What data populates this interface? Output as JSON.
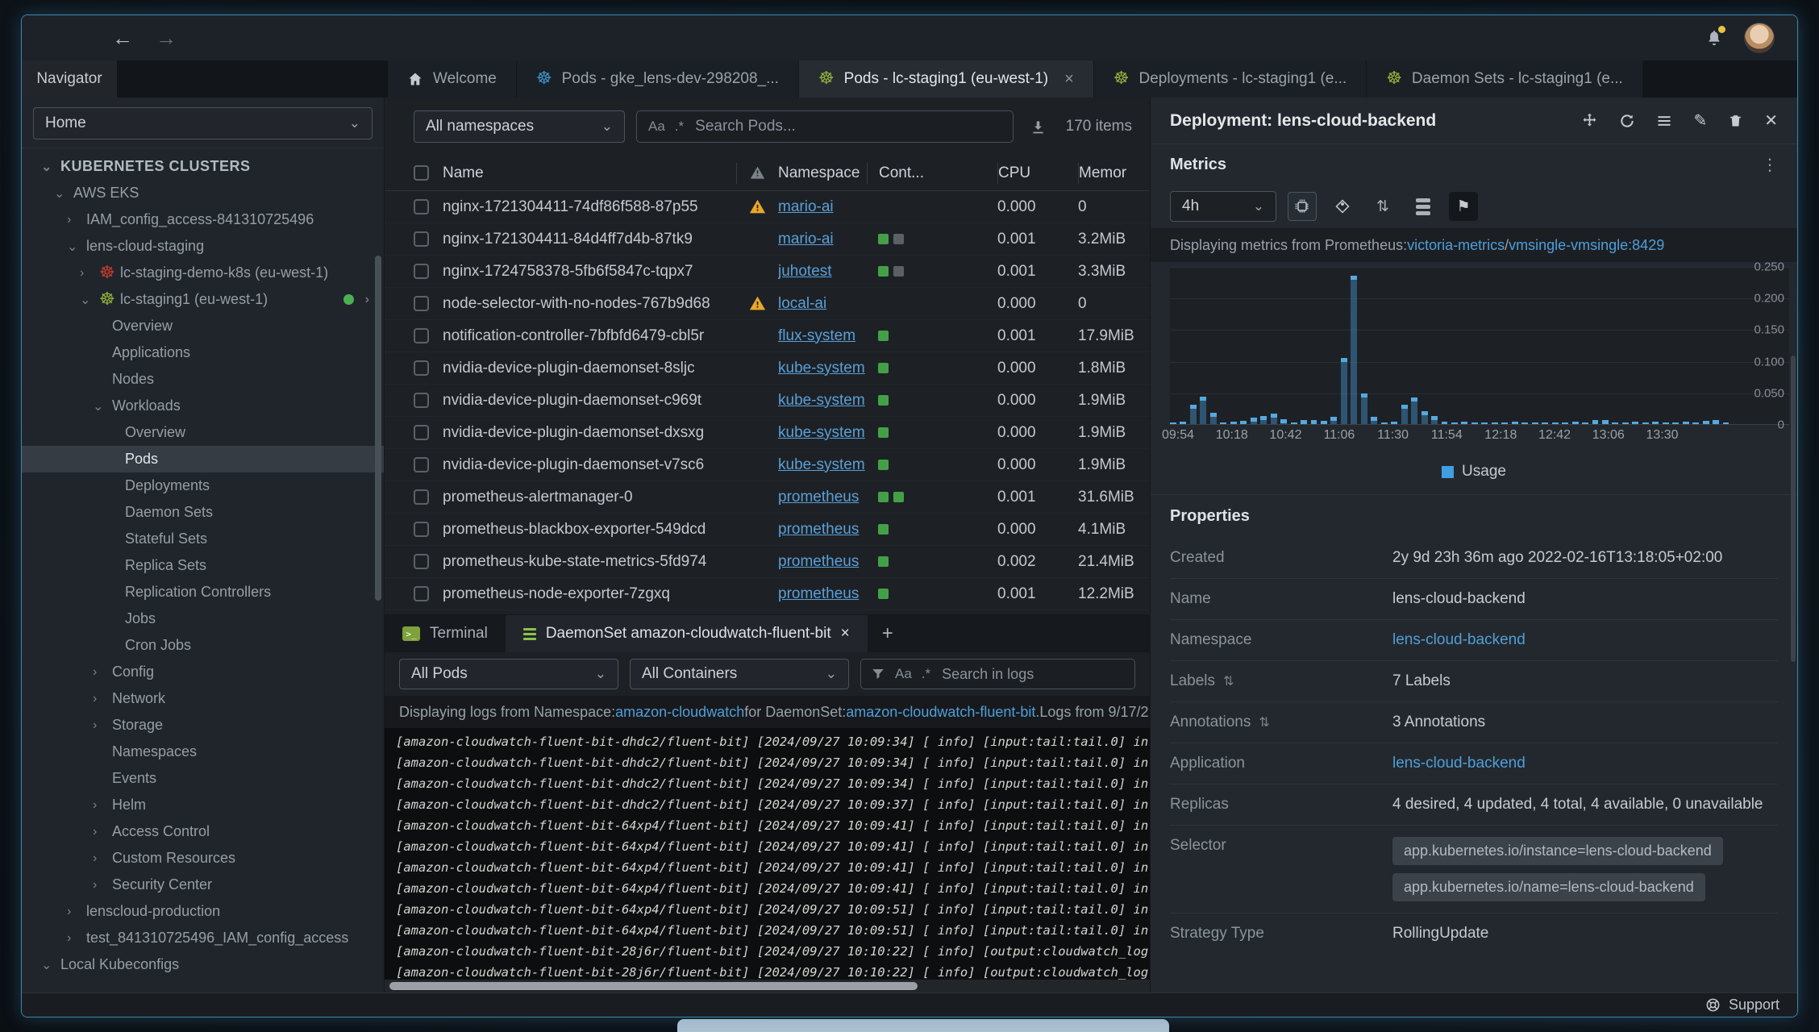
{
  "titlebar": {
    "back": "←",
    "forward": "→"
  },
  "tabs": {
    "navigator_label": "Navigator",
    "items": [
      {
        "label": "Welcome",
        "icon": "home",
        "active": false
      },
      {
        "label": "Pods - gke_lens-dev-298208_...",
        "icon": "k8s",
        "icon_color": "#3b8fc4",
        "active": false
      },
      {
        "label": "Pods - lc-staging1 (eu-west-1)",
        "icon": "k8s",
        "icon_color": "#8fae3a",
        "active": true,
        "closable": true
      },
      {
        "label": "Deployments - lc-staging1 (e...",
        "icon": "k8s",
        "icon_color": "#8fae3a",
        "active": false
      },
      {
        "label": "Daemon Sets - lc-staging1 (e...",
        "icon": "k8s",
        "icon_color": "#8fae3a",
        "active": false
      }
    ]
  },
  "sidebar": {
    "scope_select": "Home",
    "tree": [
      {
        "label": "KUBERNETES CLUSTERS",
        "depth": 0,
        "chevron": "down",
        "header": true
      },
      {
        "label": "AWS EKS",
        "depth": 1,
        "chevron": "down"
      },
      {
        "label": "IAM_config_access-841310725496",
        "depth": 2,
        "chevron": "right"
      },
      {
        "label": "lens-cloud-staging",
        "depth": 2,
        "chevron": "down"
      },
      {
        "label": "lc-staging-demo-k8s (eu-west-1)",
        "depth": 3,
        "chevron": "right",
        "icon": "k8s",
        "icon_color": "#c23b2e"
      },
      {
        "label": "lc-staging1 (eu-west-1)",
        "depth": 3,
        "chevron": "down",
        "icon": "k8s",
        "icon_color": "#8fae3a",
        "status_dot": true,
        "trail_chevron": "›"
      },
      {
        "label": "Overview",
        "depth": 4
      },
      {
        "label": "Applications",
        "depth": 4
      },
      {
        "label": "Nodes",
        "depth": 4
      },
      {
        "label": "Workloads",
        "depth": 4,
        "chevron": "down"
      },
      {
        "label": "Overview",
        "depth": 5
      },
      {
        "label": "Pods",
        "depth": 5,
        "selected": true
      },
      {
        "label": "Deployments",
        "depth": 5
      },
      {
        "label": "Daemon Sets",
        "depth": 5
      },
      {
        "label": "Stateful Sets",
        "depth": 5
      },
      {
        "label": "Replica Sets",
        "depth": 5
      },
      {
        "label": "Replication Controllers",
        "depth": 5
      },
      {
        "label": "Jobs",
        "depth": 5
      },
      {
        "label": "Cron Jobs",
        "depth": 5
      },
      {
        "label": "Config",
        "depth": 4,
        "chevron": "right"
      },
      {
        "label": "Network",
        "depth": 4,
        "chevron": "right"
      },
      {
        "label": "Storage",
        "depth": 4,
        "chevron": "right"
      },
      {
        "label": "Namespaces",
        "depth": 4
      },
      {
        "label": "Events",
        "depth": 4
      },
      {
        "label": "Helm",
        "depth": 4,
        "chevron": "right"
      },
      {
        "label": "Access Control",
        "depth": 4,
        "chevron": "right"
      },
      {
        "label": "Custom Resources",
        "depth": 4,
        "chevron": "right"
      },
      {
        "label": "Security Center",
        "depth": 4,
        "chevron": "right"
      },
      {
        "label": "lenscloud-production",
        "depth": 2,
        "chevron": "right"
      },
      {
        "label": "test_841310725496_IAM_config_access",
        "depth": 2,
        "chevron": "right"
      },
      {
        "label": "Local Kubeconfigs",
        "depth": 0,
        "chevron": "down"
      }
    ]
  },
  "pods_panel": {
    "namespace_select": "All namespaces",
    "case_icon": "Aa",
    "regex_icon": ".*",
    "search_placeholder": "Search Pods...",
    "items_count": "170 items",
    "columns": [
      "Name",
      "Namespace",
      "Cont...",
      "CPU",
      "Memor"
    ],
    "rows": [
      {
        "name": "nginx-1721304411-74df86f588-87p55",
        "warning": true,
        "namespace": "mario-ai",
        "containers": [],
        "cpu": "0.000",
        "memory": "0"
      },
      {
        "name": "nginx-1721304411-84d4ff7d4b-87tk9",
        "warning": false,
        "namespace": "mario-ai",
        "containers": [
          "ok",
          "idle"
        ],
        "cpu": "0.001",
        "memory": "3.2MiB"
      },
      {
        "name": "nginx-1724758378-5fb6f5847c-tqpx7",
        "warning": false,
        "namespace": "juhotest",
        "containers": [
          "ok",
          "idle"
        ],
        "cpu": "0.001",
        "memory": "3.3MiB"
      },
      {
        "name": "node-selector-with-no-nodes-767b9d68",
        "warning": true,
        "namespace": "local-ai",
        "containers": [],
        "cpu": "0.000",
        "memory": "0"
      },
      {
        "name": "notification-controller-7bfbfd6479-cbl5r",
        "warning": false,
        "namespace": "flux-system",
        "containers": [
          "ok"
        ],
        "cpu": "0.001",
        "memory": "17.9MiB"
      },
      {
        "name": "nvidia-device-plugin-daemonset-8sljc",
        "warning": false,
        "namespace": "kube-system",
        "containers": [
          "ok"
        ],
        "cpu": "0.000",
        "memory": "1.8MiB"
      },
      {
        "name": "nvidia-device-plugin-daemonset-c969t",
        "warning": false,
        "namespace": "kube-system",
        "containers": [
          "ok"
        ],
        "cpu": "0.000",
        "memory": "1.9MiB"
      },
      {
        "name": "nvidia-device-plugin-daemonset-dxsxg",
        "warning": false,
        "namespace": "kube-system",
        "containers": [
          "ok"
        ],
        "cpu": "0.000",
        "memory": "1.9MiB"
      },
      {
        "name": "nvidia-device-plugin-daemonset-v7sc6",
        "warning": false,
        "namespace": "kube-system",
        "containers": [
          "ok"
        ],
        "cpu": "0.000",
        "memory": "1.9MiB"
      },
      {
        "name": "prometheus-alertmanager-0",
        "warning": false,
        "namespace": "prometheus",
        "containers": [
          "ok",
          "ok"
        ],
        "cpu": "0.001",
        "memory": "31.6MiB"
      },
      {
        "name": "prometheus-blackbox-exporter-549dcd",
        "warning": false,
        "namespace": "prometheus",
        "containers": [
          "ok"
        ],
        "cpu": "0.000",
        "memory": "4.1MiB"
      },
      {
        "name": "prometheus-kube-state-metrics-5fd974",
        "warning": false,
        "namespace": "prometheus",
        "containers": [
          "ok"
        ],
        "cpu": "0.002",
        "memory": "21.4MiB"
      },
      {
        "name": "prometheus-node-exporter-7zgxq",
        "warning": false,
        "namespace": "prometheus",
        "containers": [
          "ok"
        ],
        "cpu": "0.001",
        "memory": "12.2MiB"
      }
    ]
  },
  "dock": {
    "tabs": [
      {
        "label": "Terminal",
        "icon": "terminal",
        "active": false
      },
      {
        "label": "DaemonSet amazon-cloudwatch-fluent-bit",
        "icon": "lines",
        "active": true,
        "closable": true
      }
    ],
    "new_tab": "+",
    "pods_select": "All Pods",
    "containers_select": "All Containers",
    "case_icon": "Aa",
    "regex_icon": ".*",
    "search_placeholder": "Search in logs",
    "info_segments": [
      {
        "text": "Displaying logs from Namespace: ",
        "link": false
      },
      {
        "text": "amazon-cloudwatch",
        "link": true
      },
      {
        "text": " for DaemonSet: ",
        "link": false
      },
      {
        "text": "amazon-cloudwatch-fluent-bit.",
        "link": true
      },
      {
        "text": " Logs from 9/17/2",
        "link": false
      }
    ],
    "log_lines": [
      "[amazon-cloudwatch-fluent-bit-dhdc2/fluent-bit] [2024/09/27 10:09:34] [ info] [input:tail:tail.0] in",
      "[amazon-cloudwatch-fluent-bit-dhdc2/fluent-bit] [2024/09/27 10:09:34] [ info] [input:tail:tail.0] in",
      "[amazon-cloudwatch-fluent-bit-dhdc2/fluent-bit] [2024/09/27 10:09:34] [ info] [input:tail:tail.0] in",
      "[amazon-cloudwatch-fluent-bit-dhdc2/fluent-bit] [2024/09/27 10:09:37] [ info] [input:tail:tail.0] in",
      "[amazon-cloudwatch-fluent-bit-64xp4/fluent-bit] [2024/09/27 10:09:41] [ info] [input:tail:tail.0] in",
      "[amazon-cloudwatch-fluent-bit-64xp4/fluent-bit] [2024/09/27 10:09:41] [ info] [input:tail:tail.0] in",
      "[amazon-cloudwatch-fluent-bit-64xp4/fluent-bit] [2024/09/27 10:09:41] [ info] [input:tail:tail.0] in",
      "[amazon-cloudwatch-fluent-bit-64xp4/fluent-bit] [2024/09/27 10:09:41] [ info] [input:tail:tail.0] in",
      "[amazon-cloudwatch-fluent-bit-64xp4/fluent-bit] [2024/09/27 10:09:51] [ info] [input:tail:tail.0] in",
      "[amazon-cloudwatch-fluent-bit-64xp4/fluent-bit] [2024/09/27 10:09:51] [ info] [input:tail:tail.0] in",
      "[amazon-cloudwatch-fluent-bit-28j6r/fluent-bit] [2024/09/27 10:10:22] [ info] [output:cloudwatch_log",
      "[amazon-cloudwatch-fluent-bit-28j6r/fluent-bit] [2024/09/27 10:10:22] [ info] [output:cloudwatch_log"
    ]
  },
  "detail_panel": {
    "title": "Deployment: lens-cloud-backend",
    "metrics_label": "Metrics",
    "time_range": "4h",
    "info_segments": [
      {
        "text": "Displaying metrics from Prometheus: ",
        "link": false
      },
      {
        "text": "victoria-metrics",
        "link": true
      },
      {
        "text": " / ",
        "link": false
      },
      {
        "text": "vmsingle-vmsingle:8429",
        "link": true
      }
    ],
    "properties_title": "Properties",
    "properties": [
      {
        "label": "Created",
        "value": "2y 9d 23h 36m ago 2022-02-16T13:18:05+02:00"
      },
      {
        "label": "Name",
        "value": "lens-cloud-backend"
      },
      {
        "label": "Namespace",
        "value": "lens-cloud-backend",
        "link": true
      },
      {
        "label": "Labels",
        "value": "7 Labels",
        "sortable": true
      },
      {
        "label": "Annotations",
        "value": "3 Annotations",
        "sortable": true
      },
      {
        "label": "Application",
        "value": "lens-cloud-backend",
        "link": true
      },
      {
        "label": "Replicas",
        "value": "4 desired, 4 updated, 4 total, 4 available, 0 unavailable"
      },
      {
        "label": "Selector",
        "chips": [
          "app.kubernetes.io/instance=lens-cloud-backend",
          "app.kubernetes.io/name=lens-cloud-backend"
        ]
      },
      {
        "label": "Strategy Type",
        "value": "RollingUpdate"
      }
    ],
    "support_label": "Support"
  },
  "chart_data": {
    "type": "bar",
    "title": "",
    "xlabel": "",
    "ylabel": "",
    "ylim": [
      0,
      0.25
    ],
    "grid": true,
    "legend_position": "bottom",
    "bar_color": "#3d7fb0",
    "cap_color": "#55a9e0",
    "x_ticks": [
      "09:54",
      "10:18",
      "10:42",
      "11:06",
      "11:30",
      "11:54",
      "12:18",
      "12:42",
      "13:06",
      "13:30"
    ],
    "x_tick_pct": [
      0,
      10.39,
      20.78,
      31.17,
      41.56,
      51.95,
      62.34,
      72.73,
      83.12,
      93.51
    ],
    "y_ticks": [
      "0.250",
      "0.200",
      "0.150",
      "0.100",
      "0.050",
      "0"
    ],
    "series": [
      {
        "name": "Usage",
        "values": [
          0.002,
          0.004,
          0.03,
          0.043,
          0.018,
          0.003,
          0.004,
          0.005,
          0.01,
          0.013,
          0.016,
          0.008,
          0.003,
          0.006,
          0.007,
          0.005,
          0.011,
          0.105,
          0.235,
          0.048,
          0.012,
          0.003,
          0.004,
          0.03,
          0.042,
          0.02,
          0.013,
          0.004,
          0.003,
          0.004,
          0.003,
          0.002,
          0.003,
          0.002,
          0.004,
          0.003,
          0.002,
          0.003,
          0.002,
          0.003,
          0.004,
          0.003,
          0.006,
          0.007,
          0.003,
          0.002,
          0.004,
          0.003,
          0.004,
          0.003,
          0.002,
          0.004,
          0.003,
          0.005,
          0.006,
          0.003
        ]
      }
    ]
  }
}
